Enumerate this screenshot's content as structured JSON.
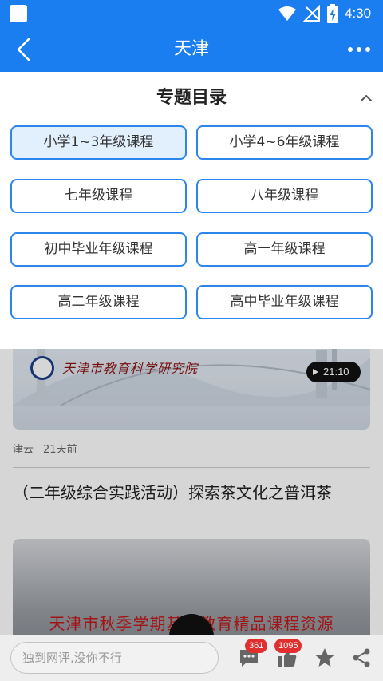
{
  "status_bar": {
    "time": "4:30"
  },
  "header": {
    "title": "天津",
    "back_icon": "back-arrow-icon",
    "more_icon": "more-dots-icon"
  },
  "panel": {
    "title": "专题目录",
    "collapse_icon": "chevron-up-icon",
    "topics": [
      {
        "label": "小学1~3年级课程",
        "selected": true
      },
      {
        "label": "小学4~6年级课程",
        "selected": false
      },
      {
        "label": "七年级课程",
        "selected": false
      },
      {
        "label": "八年级课程",
        "selected": false
      },
      {
        "label": "初中毕业年级课程",
        "selected": false
      },
      {
        "label": "高一年级课程",
        "selected": false
      },
      {
        "label": "高二年级课程",
        "selected": false
      },
      {
        "label": "高中毕业年级课程",
        "selected": false
      }
    ]
  },
  "feed": {
    "video1": {
      "institute": "天津市教育科学研究院",
      "duration": "21:10"
    },
    "meta": {
      "source": "津云",
      "time_ago": "21天前"
    },
    "article_title": "（二年级综合实践活动）探索茶文化之普洱茶",
    "video2": {
      "banner": "天津市秋季学期基础教育精品课程资源"
    }
  },
  "bottom_bar": {
    "comment_placeholder": "独到网评,没你不行",
    "comments_count": "361",
    "likes_count": "1095"
  },
  "colors": {
    "brand": "#1a7df0",
    "badge": "#e12f2f",
    "topic_border": "#2a86ec",
    "selected_bg": "#e2effd"
  }
}
